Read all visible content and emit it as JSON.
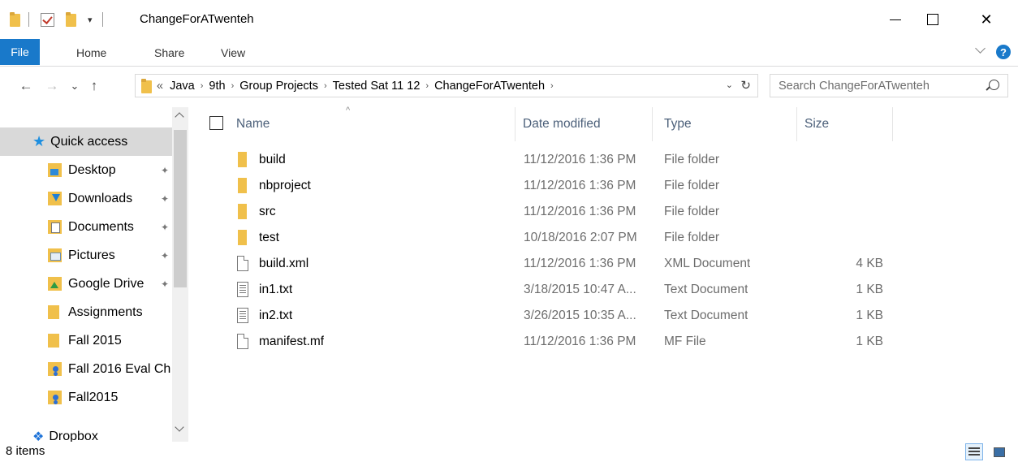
{
  "window": {
    "title": "ChangeForATwenteh",
    "minimize": "—",
    "close": "✕"
  },
  "ribbon": {
    "tabs": [
      "File",
      "Home",
      "Share",
      "View"
    ],
    "help": "?"
  },
  "nav_buttons": {
    "back": "←",
    "forward": "→",
    "recent": "⌄",
    "up": "↑"
  },
  "address": {
    "overflow": "«",
    "crumbs": [
      "Java",
      "9th",
      "Group Projects",
      "Tested Sat 11 12",
      "ChangeForATwenteh"
    ],
    "separator": "›",
    "dropdown": "⌄",
    "refresh": "↻"
  },
  "search": {
    "placeholder": "Search ChangeForATwenteh"
  },
  "navpane": {
    "items": [
      {
        "label": "Quick access",
        "icon": "star-icon"
      },
      {
        "label": "Desktop",
        "icon": "desktop-folder-icon",
        "pinned": true
      },
      {
        "label": "Downloads",
        "icon": "downloads-folder-icon",
        "pinned": true
      },
      {
        "label": "Documents",
        "icon": "documents-folder-icon",
        "pinned": true
      },
      {
        "label": "Pictures",
        "icon": "pictures-folder-icon",
        "pinned": true
      },
      {
        "label": "Google Drive",
        "icon": "google-drive-folder-icon",
        "pinned": true
      },
      {
        "label": "Assignments",
        "icon": "folder-icon"
      },
      {
        "label": "Fall 2015",
        "icon": "folder-icon"
      },
      {
        "label": "Fall 2016 Eval Ch",
        "icon": "shared-folder-icon"
      },
      {
        "label": "Fall2015",
        "icon": "shared-folder-icon"
      },
      {
        "label": "Dropbox",
        "icon": "dropbox-icon"
      }
    ],
    "pin_glyph": "📌"
  },
  "columns": {
    "name": "Name",
    "date": "Date modified",
    "type": "Type",
    "size": "Size",
    "sort_glyph": "^"
  },
  "files": [
    {
      "name": "build",
      "date": "11/12/2016 1:36 PM",
      "type": "File folder",
      "size": "",
      "kind": "folder"
    },
    {
      "name": "nbproject",
      "date": "11/12/2016 1:36 PM",
      "type": "File folder",
      "size": "",
      "kind": "folder"
    },
    {
      "name": "src",
      "date": "11/12/2016 1:36 PM",
      "type": "File folder",
      "size": "",
      "kind": "folder"
    },
    {
      "name": "test",
      "date": "10/18/2016 2:07 PM",
      "type": "File folder",
      "size": "",
      "kind": "folder"
    },
    {
      "name": "build.xml",
      "date": "11/12/2016 1:36 PM",
      "type": "XML Document",
      "size": "4 KB",
      "kind": "file"
    },
    {
      "name": "in1.txt",
      "date": "3/18/2015 10:47 A...",
      "type": "Text Document",
      "size": "1 KB",
      "kind": "text"
    },
    {
      "name": "in2.txt",
      "date": "3/26/2015 10:35 A...",
      "type": "Text Document",
      "size": "1 KB",
      "kind": "text"
    },
    {
      "name": "manifest.mf",
      "date": "11/12/2016 1:36 PM",
      "type": "MF File",
      "size": "1 KB",
      "kind": "file"
    }
  ],
  "status": {
    "item_count": "8 items"
  },
  "colors": {
    "accent": "#1979ca",
    "folder": "#f0c04b",
    "selected": "#cce8ff"
  }
}
